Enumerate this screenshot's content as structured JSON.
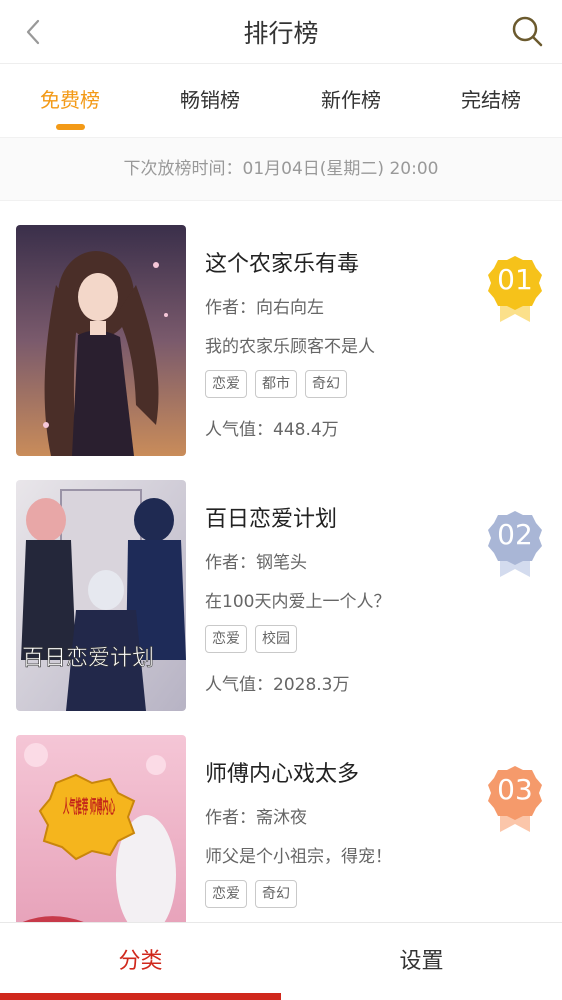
{
  "header": {
    "title": "排行榜"
  },
  "tabs": [
    {
      "label": "免费榜",
      "active": true
    },
    {
      "label": "畅销榜",
      "active": false
    },
    {
      "label": "新作榜",
      "active": false
    },
    {
      "label": "完结榜",
      "active": false
    }
  ],
  "notice": "下次放榜时间：01月04日(星期二) 20:00",
  "books": [
    {
      "rank": "01",
      "title": "这个农家乐有毒",
      "author": "作者：向右向左",
      "desc": "我的农家乐顾客不是人",
      "tags": [
        "恋爱",
        "都市",
        "奇幻"
      ],
      "popularity": "人气值：448.4万",
      "badge_color": "#f6c21a"
    },
    {
      "rank": "02",
      "title": "百日恋爱计划",
      "author": "作者：钢笔头",
      "desc": "在100天内爱上一个人？",
      "tags": [
        "恋爱",
        "校园"
      ],
      "popularity": "人气值：2028.3万",
      "badge_color": "#a9b6d6"
    },
    {
      "rank": "03",
      "title": "师傅内心戏太多",
      "author": "作者：斋沐夜",
      "desc": "师父是个小祖宗，得宠！",
      "tags": [
        "恋爱",
        "奇幻"
      ],
      "popularity": "",
      "badge_color": "#f59a6b"
    }
  ],
  "covers": [
    {
      "lettering": ""
    },
    {
      "lettering": "百日恋爱计划"
    },
    {
      "lettering": "人气推荐 师傅内心"
    }
  ],
  "bottom_nav": [
    {
      "label": "分类",
      "active": true
    },
    {
      "label": "设置",
      "active": false
    }
  ],
  "colors": {
    "accent": "#f39a17",
    "bottom_active": "#d0281c"
  },
  "icons": {
    "back": "chevron-left-icon",
    "search": "search-icon"
  }
}
